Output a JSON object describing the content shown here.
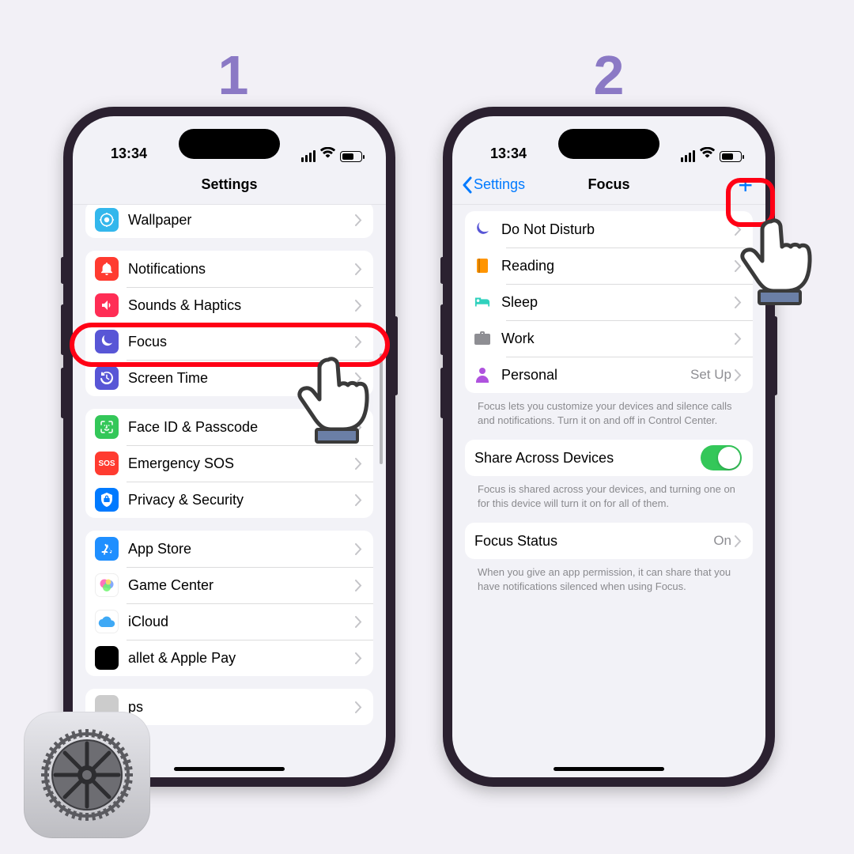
{
  "step1": {
    "num": "1"
  },
  "step2": {
    "num": "2"
  },
  "status": {
    "time": "13:34"
  },
  "screen1": {
    "title": "Settings",
    "group0": {
      "wallpaper": "Wallpaper"
    },
    "group1": {
      "notifications": "Notifications",
      "sounds": "Sounds & Haptics",
      "focus": "Focus",
      "screentime": "Screen Time"
    },
    "group2": {
      "faceid": "Face ID & Passcode",
      "sos": "Emergency SOS",
      "privacy": "Privacy & Security"
    },
    "group3": {
      "appstore": "App Store",
      "gamecenter": "Game Center",
      "icloud": "iCloud",
      "wallet": "allet & Apple Pay"
    },
    "group4": {
      "partial": "ps"
    }
  },
  "screen2": {
    "back": "Settings",
    "title": "Focus",
    "modes": {
      "dnd": "Do Not Disturb",
      "reading": "Reading",
      "sleep": "Sleep",
      "work": "Work",
      "personal": "Personal",
      "personal_val": "Set Up"
    },
    "note1": "Focus lets you customize your devices and silence calls and notifications. Turn it on and off in Control Center.",
    "share_label": "Share Across Devices",
    "note2": "Focus is shared across your devices, and turning one on for this device will turn it on for all of them.",
    "status_label": "Focus Status",
    "status_val": "On",
    "note3": "When you give an app permission, it can share that you have notifications silenced when using Focus."
  }
}
